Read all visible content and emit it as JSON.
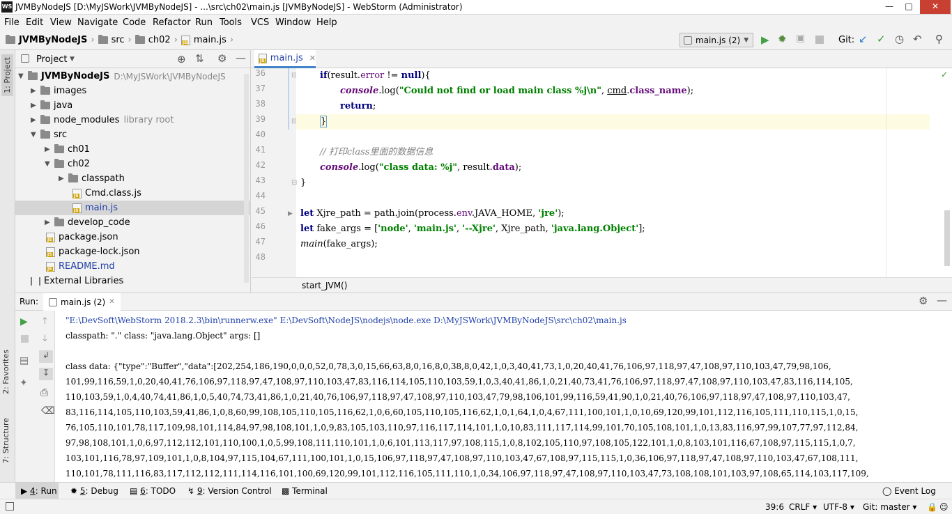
{
  "window": {
    "logo": "WS",
    "title": "JVMByNodeJS [D:\\MyJSWork\\JVMByNodeJS] - ...\\src\\ch02\\main.js [JVMByNodeJS] - WebStorm (Administrator)"
  },
  "menu": [
    "File",
    "Edit",
    "View",
    "Navigate",
    "Code",
    "Refactor",
    "Run",
    "Tools",
    "VCS",
    "Window",
    "Help"
  ],
  "breadcrumbs": [
    "JVMByNodeJS",
    "src",
    "ch02",
    "main.js"
  ],
  "run_config": "main.js (2)",
  "git_label": "Git:",
  "project_panel": {
    "title": "Project",
    "tree": [
      {
        "label": "JVMByNodeJS",
        "hint": "D:\\MyJSWork\\JVMByNodeJS"
      },
      {
        "label": "images"
      },
      {
        "label": "java"
      },
      {
        "label": "node_modules",
        "hint": "library root"
      },
      {
        "label": "src"
      },
      {
        "label": "ch01"
      },
      {
        "label": "ch02"
      },
      {
        "label": "classpath"
      },
      {
        "label": "Cmd.class.js"
      },
      {
        "label": "main.js"
      },
      {
        "label": "develop_code"
      },
      {
        "label": "package.json"
      },
      {
        "label": "package-lock.json"
      },
      {
        "label": "README.md"
      },
      {
        "label": "External Libraries"
      }
    ]
  },
  "left_tabs": [
    "1: Project",
    "2: Favorites",
    "7: Structure"
  ],
  "editor": {
    "tab": "main.js",
    "line_numbers": [
      "36",
      "37",
      "38",
      "39",
      "40",
      "41",
      "42",
      "43",
      "44",
      "45",
      "46",
      "47",
      "48"
    ],
    "code": {
      "l36_kw": "if",
      "l36_a": "(result.",
      "l36_b": "error",
      "l36_c": " != ",
      "l36_d": "null",
      "l36_e": "){",
      "l37_con": "console",
      "l37_a": ".log(",
      "l37_str": "\"Could not find or load main class %j\\n\"",
      "l37_b": ", ",
      "l37_c": "cmd",
      "l37_d": ".",
      "l37_e": "class_name",
      "l37_f": ");",
      "l38_kw": "return",
      "l38_a": ";",
      "l39": "}",
      "l41_cmt": "// 打印class里面的数据信息",
      "l42_con": "console",
      "l42_a": ".log(",
      "l42_str": "\"class data: %j\"",
      "l42_b": ", result.",
      "l42_c": "data",
      "l42_d": ");",
      "l43": "}",
      "l45_kw": "let",
      "l45_a": " Xjre_path = path.join(process.",
      "l45_b": "env",
      "l45_c": ".",
      "l45_d": "JAVA_HOME",
      "l45_e": ", ",
      "l45_str": "'jre'",
      "l45_f": ");",
      "l46_kw": "let",
      "l46_a": " fake_args = [",
      "l46_s1": "'node'",
      "l46_s2": "'main.js'",
      "l46_s3": "'--Xjre'",
      "l46_b": ", Xjre_path, ",
      "l46_s4": "'java.lang.Object'",
      "l46_c": "];",
      "l46_sep": ", ",
      "l47_a": "main",
      "l47_b": "(fake_args);"
    },
    "function_breadcrumb": "start_JVM()"
  },
  "run_panel": {
    "label": "Run:",
    "tab": "main.js (2)",
    "console": [
      "\"E:\\DevSoft\\WebStorm 2018.2.3\\bin\\runnerw.exe\" E:\\DevSoft\\NodeJS\\nodejs\\node.exe D:\\MyJSWork\\JVMByNodeJS\\src\\ch02\\main.js",
      "classpath: \".\" class: \"java.lang.Object\" args: []",
      "",
      "class data: {\"type\":\"Buffer\",\"data\":[202,254,186,190,0,0,0,52,0,78,3,0,15,66,63,8,0,16,8,0,38,8,0,42,1,0,3,40,41,73,1,0,20,40,41,76,106,97,118,97,47,108,97,110,103,47,79,98,106,",
      "  101,99,116,59,1,0,20,40,41,76,106,97,118,97,47,108,97,110,103,47,83,116,114,105,110,103,59,1,0,3,40,41,86,1,0,21,40,73,41,76,106,97,118,97,47,108,97,110,103,47,83,116,114,105,",
      "  110,103,59,1,0,4,40,74,41,86,1,0,5,40,74,73,41,86,1,0,21,40,76,106,97,118,97,47,108,97,110,103,47,79,98,106,101,99,116,59,41,90,1,0,21,40,76,106,97,118,97,47,108,97,110,103,47,",
      "  83,116,114,105,110,103,59,41,86,1,0,8,60,99,108,105,110,105,116,62,1,0,6,60,105,110,105,116,62,1,0,1,64,1,0,4,67,111,100,101,1,0,10,69,120,99,101,112,116,105,111,110,115,1,0,15,",
      "  76,105,110,101,78,117,109,98,101,114,84,97,98,108,101,1,0,9,83,105,103,110,97,116,117,114,101,1,0,10,83,111,117,114,99,101,70,105,108,101,1,0,13,83,116,97,99,107,77,97,112,84,",
      "  97,98,108,101,1,0,6,97,112,112,101,110,100,1,0,5,99,108,111,110,101,1,0,6,101,113,117,97,108,115,1,0,8,102,105,110,97,108,105,122,101,1,0,8,103,101,116,67,108,97,115,115,1,0,7,",
      "  103,101,116,78,97,109,101,1,0,8,104,97,115,104,67,111,100,101,1,0,15,106,97,118,97,47,108,97,110,103,47,67,108,97,115,115,1,0,36,106,97,118,97,47,108,97,110,103,47,67,108,111,",
      "  110,101,78,111,116,83,117,112,112,111,114,116,101,100,69,120,99,101,112,116,105,111,110,1,0,34,106,97,118,97,47,108,97,110,103,47,73,108,108,101,103,97,108,65,114,103,117,109,"
    ]
  },
  "bottom_tabs": [
    {
      "num": "4",
      "label": ": Run"
    },
    {
      "num": "5",
      "label": ": Debug"
    },
    {
      "num": "6",
      "label": ": TODO"
    },
    {
      "num": "9",
      "label": ": Version Control"
    },
    {
      "num": "",
      "label": "Terminal"
    }
  ],
  "event_log": "Event Log",
  "status": {
    "position": "39:6",
    "line_sep": "CRLF",
    "encoding": "UTF-8",
    "git_branch": "Git: master"
  }
}
